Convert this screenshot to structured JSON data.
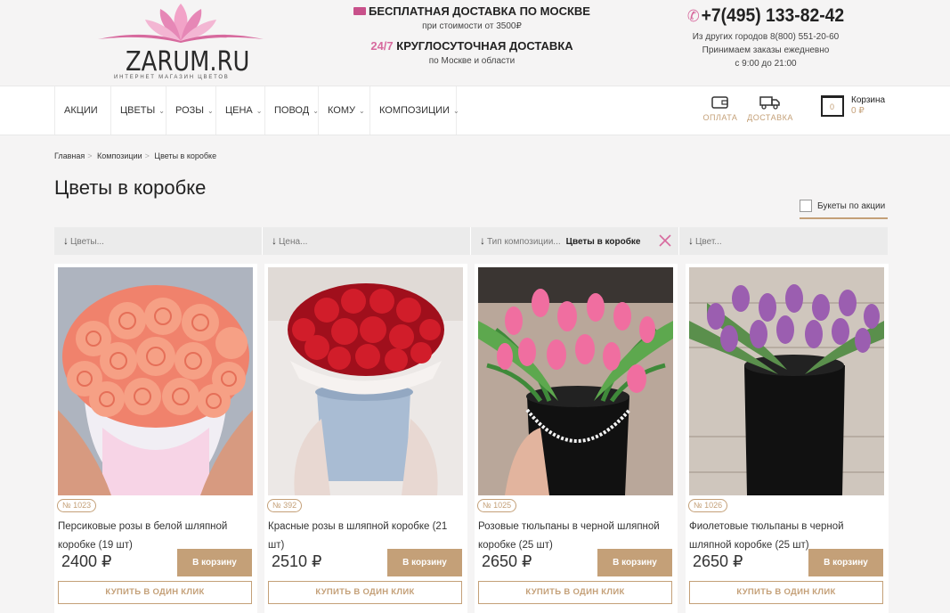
{
  "header": {
    "logo_text": "ZARUM.RU",
    "logo_sub": "ИНТЕРНЕТ МАГАЗИН ЦВЕТОВ",
    "delivery_title": "БЕСПЛАТНАЯ ДОСТАВКА ПО МОСКВЕ",
    "delivery_sub": "при стоимости от 3500₽",
    "delivery247_prefix": "24/7",
    "delivery247_title": "КРУГЛОСУТОЧНАЯ ДОСТАВКА",
    "delivery247_sub": "по Москве и области",
    "phone": "+7(495) 133-82-42",
    "phone_other": "Из других городов 8(800) 551-20-60",
    "hours_line1": "Принимаем заказы ежедневно",
    "hours_line2": "с 9:00 до 21:00"
  },
  "nav": {
    "items": [
      {
        "label": "АКЦИИ"
      },
      {
        "label": "ЦВЕТЫ"
      },
      {
        "label": "РОЗЫ"
      },
      {
        "label": "ЦЕНА"
      },
      {
        "label": "ПОВОД"
      },
      {
        "label": "КОМУ"
      },
      {
        "label": "КОМПОЗИЦИИ"
      }
    ],
    "payment_label": "ОПЛАТА",
    "delivery_label": "ДОСТАВКА",
    "cart_label": "Корзина",
    "cart_count": "0",
    "cart_sum": "0 ₽"
  },
  "breadcrumb": [
    "Главная",
    "Композиции",
    "Цветы в коробке"
  ],
  "page_title": "Цветы в коробке",
  "promo_filter_label": "Букеты по акции",
  "filters": [
    {
      "label": "Цветы...",
      "value": ""
    },
    {
      "label": "Цена...",
      "value": ""
    },
    {
      "label": "Тип композиции...",
      "value": "Цветы в коробке"
    },
    {
      "label": "Цвет...",
      "value": ""
    }
  ],
  "products": [
    {
      "number": "№ 1023",
      "name": "Персиковые розы в белой шляпной коробке (19 шт)",
      "price": "2400 ₽",
      "cart_button": "В корзину",
      "oneclick_button": "КУПИТЬ В ОДИН КЛИК"
    },
    {
      "number": "№ 392",
      "name": "Красные розы в шляпной коробке (21 шт)",
      "price": "2510 ₽",
      "cart_button": "В корзину",
      "oneclick_button": "КУПИТЬ В ОДИН КЛИК"
    },
    {
      "number": "№ 1025",
      "name": "Розовые тюльпаны в черной шляпной коробке (25 шт)",
      "price": "2650 ₽",
      "cart_button": "В корзину",
      "oneclick_button": "КУПИТЬ В ОДИН КЛИК"
    },
    {
      "number": "№ 1026",
      "name": "Фиолетовые тюльпаны в черной шляпной коробке (25 шт)",
      "price": "2650 ₽",
      "cart_button": "В корзину",
      "oneclick_button": "КУПИТЬ В ОДИН КЛИК"
    }
  ],
  "colors": {
    "accent": "#c4a078",
    "pink": "#d76a9e"
  }
}
